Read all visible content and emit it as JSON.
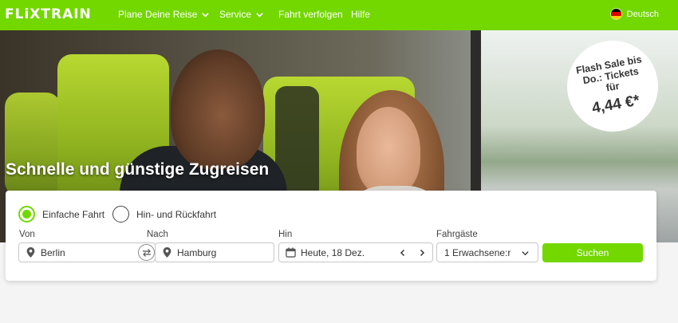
{
  "header": {
    "logo": "FLiXTRAIN",
    "nav": [
      {
        "label": "Plane Deine Reise",
        "dropdown": true
      },
      {
        "label": "Service",
        "dropdown": true
      },
      {
        "label": "Fahrt verfolgen",
        "dropdown": false
      },
      {
        "label": "Hilfe",
        "dropdown": false
      }
    ],
    "language": "Deutsch",
    "language_flag": "flag-germany-icon"
  },
  "hero": {
    "title": "Schnelle und günstige Zugreisen",
    "badge_text": "Flash Sale bis Do.: Tickets für",
    "badge_price": "4,44 €*"
  },
  "search": {
    "trip_type": {
      "one_way": "Einfache Fahrt",
      "round_trip": "Hin- und Rückfahrt",
      "selected": "one_way"
    },
    "from_label": "Von",
    "from_value": "Berlin",
    "to_label": "Nach",
    "to_value": "Hamburg",
    "date_label": "Hin",
    "date_value": "Heute, 18 Dez.",
    "passengers_label": "Fahrgäste",
    "passengers_value": "1 Erwachsene:r",
    "submit": "Suchen"
  },
  "colors": {
    "brand": "#73d700",
    "text": "#353535"
  }
}
